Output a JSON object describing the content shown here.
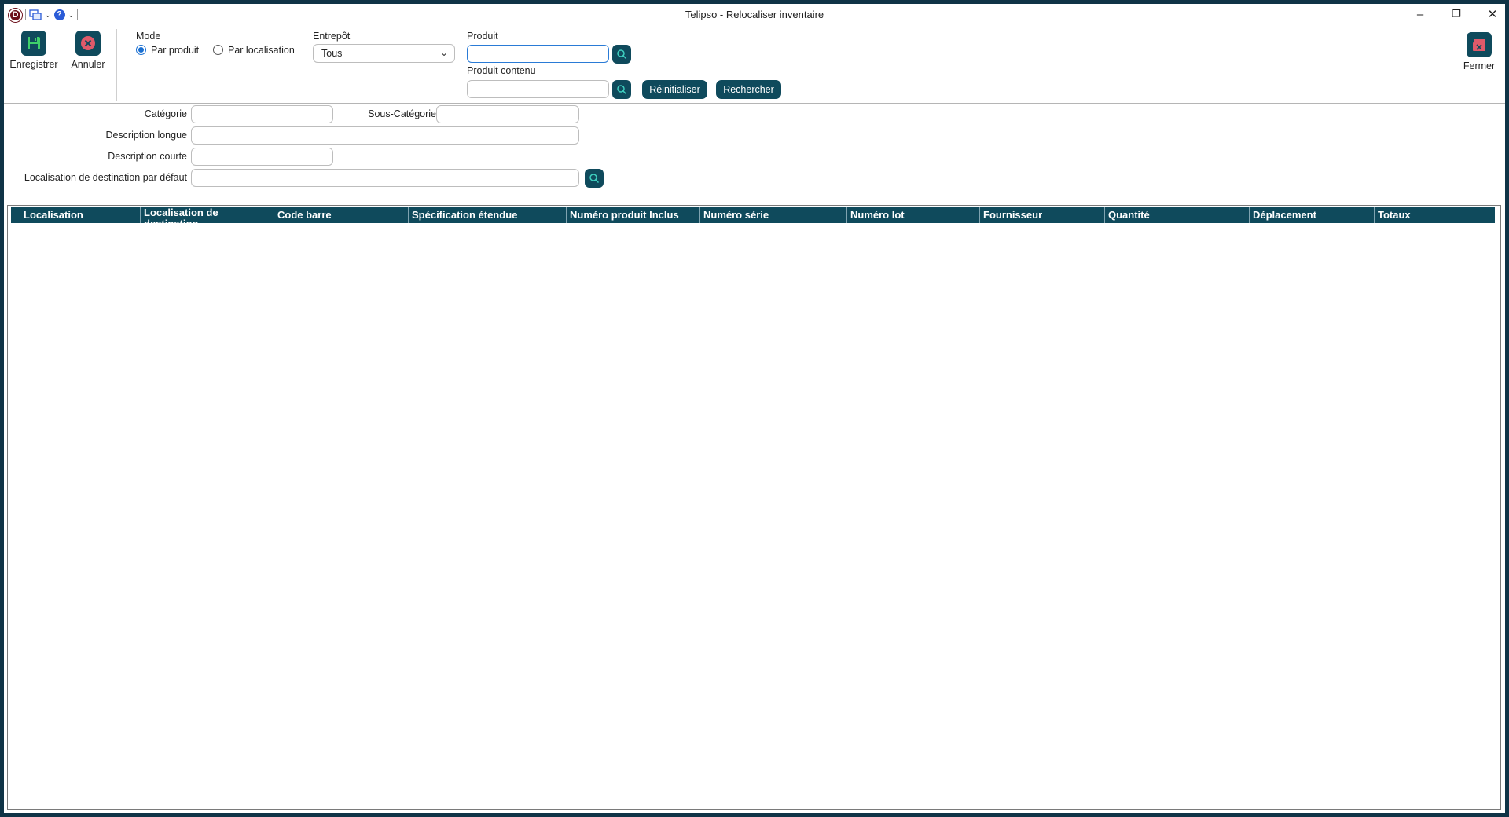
{
  "window": {
    "title": "Telipso - Relocaliser inventaire",
    "app_logo_letter": "D",
    "controls": {
      "minimize": "–",
      "restore": "❐",
      "close": "✕"
    }
  },
  "toolbar": {
    "save_label": "Enregistrer",
    "cancel_label": "Annuler",
    "close_label": "Fermer"
  },
  "mode": {
    "label": "Mode",
    "options": [
      "Par produit",
      "Par localisation"
    ],
    "selected": "Par produit"
  },
  "warehouse": {
    "label": "Entrepôt",
    "value": "Tous"
  },
  "product": {
    "label": "Produit",
    "value": ""
  },
  "contained_product": {
    "label": "Produit contenu",
    "value": ""
  },
  "actions": {
    "reset_label": "Réinitialiser",
    "search_label": "Rechercher"
  },
  "filters": {
    "category_label": "Catégorie",
    "category_value": "",
    "subcategory_label": "Sous-Catégorie",
    "subcategory_value": "",
    "long_desc_label": "Description longue",
    "long_desc_value": "",
    "short_desc_label": "Description courte",
    "short_desc_value": "",
    "default_dest_label": "Localisation de destination par défaut",
    "default_dest_value": ""
  },
  "grid": {
    "columns": [
      "Localisation",
      "Localisation de destination",
      "Code barre",
      "Spécification étendue",
      "Numéro produit Inclus",
      "Numéro série",
      "Numéro lot",
      "Fournisseur",
      "Quantité",
      "Déplacement",
      "Totaux"
    ],
    "rows": []
  },
  "colors": {
    "accent": "#0f4a5c",
    "frame": "#0f3346",
    "focus": "#2a7bd6",
    "save_icon": "#3fd06a",
    "cancel_icon": "#e05a6a"
  }
}
